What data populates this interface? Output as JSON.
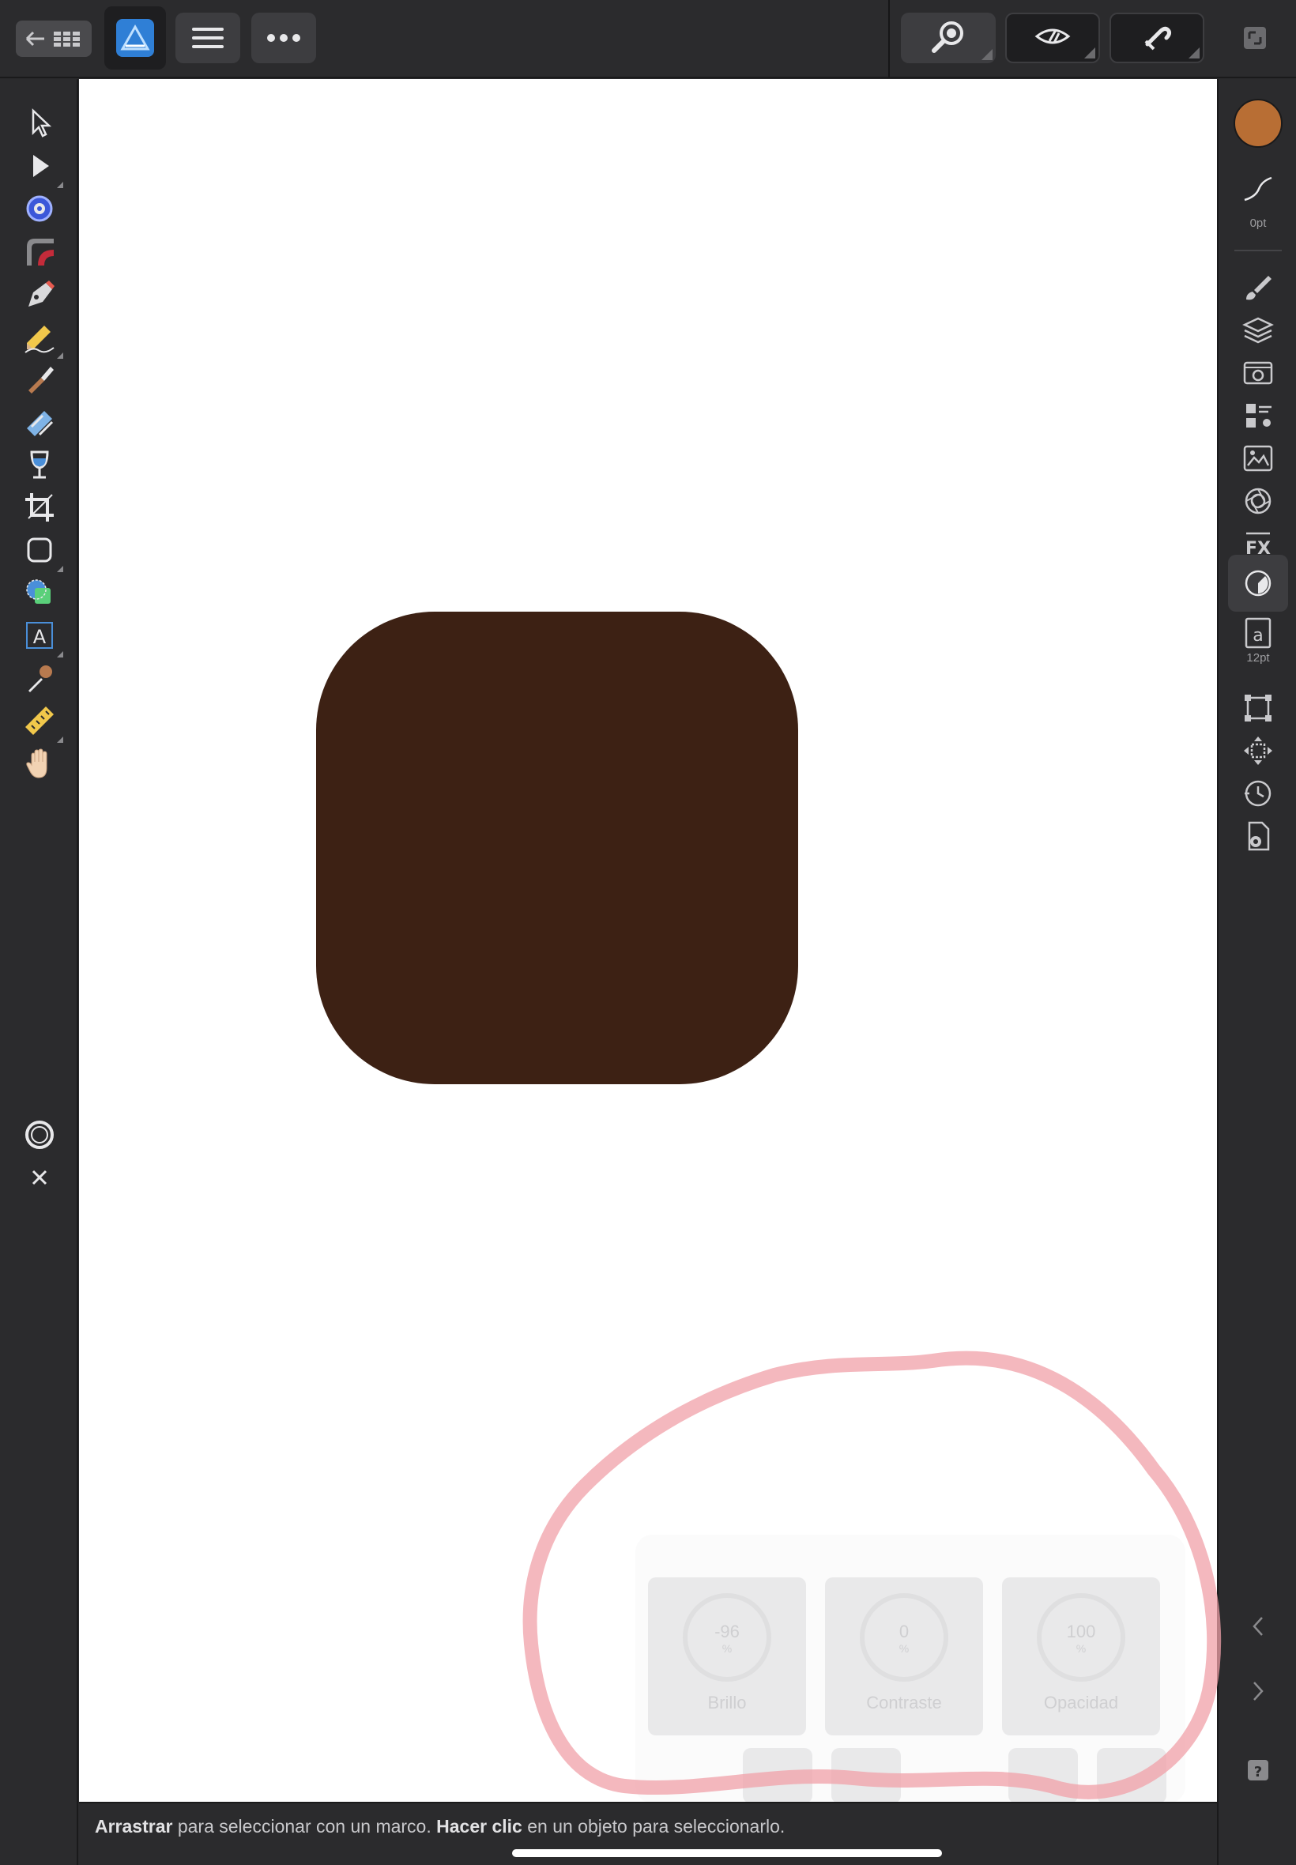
{
  "colors": {
    "shape_fill": "#3d2114",
    "fill_swatch": "#b86e34",
    "app_icon_bg": "#2f7fd6",
    "annotation": "#f0a0a8"
  },
  "topbar": {
    "back_icon": "arrow-left-icon",
    "grid_icon": "grid-icon",
    "app_icon": "affinity-designer-icon",
    "menu_icon": "hamburger-menu-icon",
    "more_icon": "more-dots-icon",
    "zoom_icon": "zoom-icon",
    "view_icon": "view-mode-icon",
    "snapping_icon": "snapping-magnet-icon",
    "window_icon": "window-toggle-icon"
  },
  "left_tools": [
    {
      "name": "move-tool-icon"
    },
    {
      "name": "node-tool-icon"
    },
    {
      "name": "corner-tool-icon"
    },
    {
      "name": "gradient-tool-icon"
    },
    {
      "name": "pen-tool-icon"
    },
    {
      "name": "pencil-tool-icon"
    },
    {
      "name": "vector-brush-tool-icon"
    },
    {
      "name": "fill-tool-icon"
    },
    {
      "name": "transparency-tool-icon"
    },
    {
      "name": "crop-tool-icon"
    },
    {
      "name": "rectangle-tool-icon"
    },
    {
      "name": "shape-builder-icon"
    },
    {
      "name": "artistic-text-tool-icon"
    },
    {
      "name": "color-picker-tool-icon"
    },
    {
      "name": "measure-tool-icon"
    },
    {
      "name": "view-hand-tool-icon"
    }
  ],
  "left_bottom": {
    "quick_menu_icon": "quick-menu-circle-icon",
    "close_icon": "close-icon"
  },
  "studio": {
    "stroke_width_label": "0pt",
    "text_size_label": "12pt",
    "panels": [
      "brushes-panel-icon",
      "layers-panel-icon",
      "stock-panel-icon",
      "appearance-panel-icon",
      "assets-panel-icon",
      "snapping-panel-icon",
      "effects-panel-icon",
      "adjustments-panel-icon",
      "text-panel-icon",
      "transform-panel-icon",
      "navigator-panel-icon",
      "history-panel-icon",
      "document-settings-icon"
    ],
    "collapse_icon": "chevron-left-icon",
    "expand_icon": "chevron-right-icon",
    "help_icon": "help-icon"
  },
  "context_toolbar": {
    "cards": [
      {
        "value": "-96",
        "unit": "%",
        "label": "Brillo"
      },
      {
        "value": "0",
        "unit": "%",
        "label": "Contraste"
      },
      {
        "value": "100",
        "unit": "%",
        "label": "Opacidad"
      }
    ]
  },
  "status": {
    "drag_bold": "Arrastrar",
    "drag_rest": " para seleccionar con un marco. ",
    "click_bold": "Hacer clic",
    "click_rest": " en un objeto para seleccionarlo."
  }
}
